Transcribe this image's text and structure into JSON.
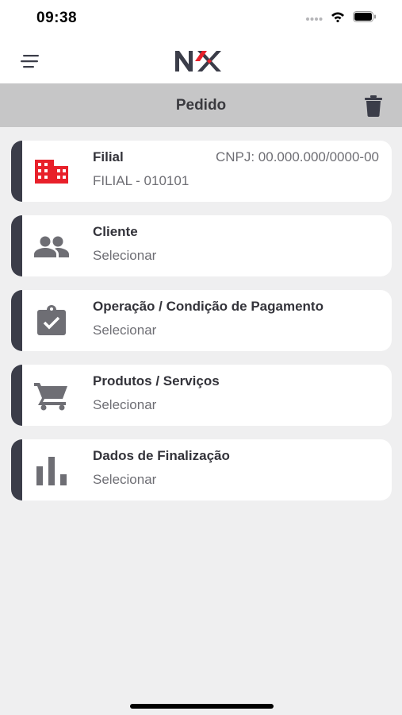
{
  "status_bar": {
    "time": "09:38"
  },
  "header": {
    "logo_text": "NX",
    "menu_icon": "menu-icon"
  },
  "title_bar": {
    "title": "Pedido",
    "delete_icon": "trash-icon"
  },
  "colors": {
    "accent": "#e8202a",
    "card_stripe": "#3b3d49",
    "icon_gray": "#6e6e74"
  },
  "cards": [
    {
      "title": "Filial",
      "subtitle": "FILIAL - 010101",
      "right": "CNPJ: 00.000.000/0000-00",
      "icon": "building-icon"
    },
    {
      "title": "Cliente",
      "subtitle": "Selecionar",
      "icon": "people-icon"
    },
    {
      "title": "Operação / Condição de Pagamento",
      "subtitle": "Selecionar",
      "icon": "clipboard-check-icon"
    },
    {
      "title": "Produtos / Serviços",
      "subtitle": "Selecionar",
      "icon": "cart-icon"
    },
    {
      "title": "Dados de Finalização",
      "subtitle": "Selecionar",
      "icon": "bar-chart-icon"
    }
  ]
}
